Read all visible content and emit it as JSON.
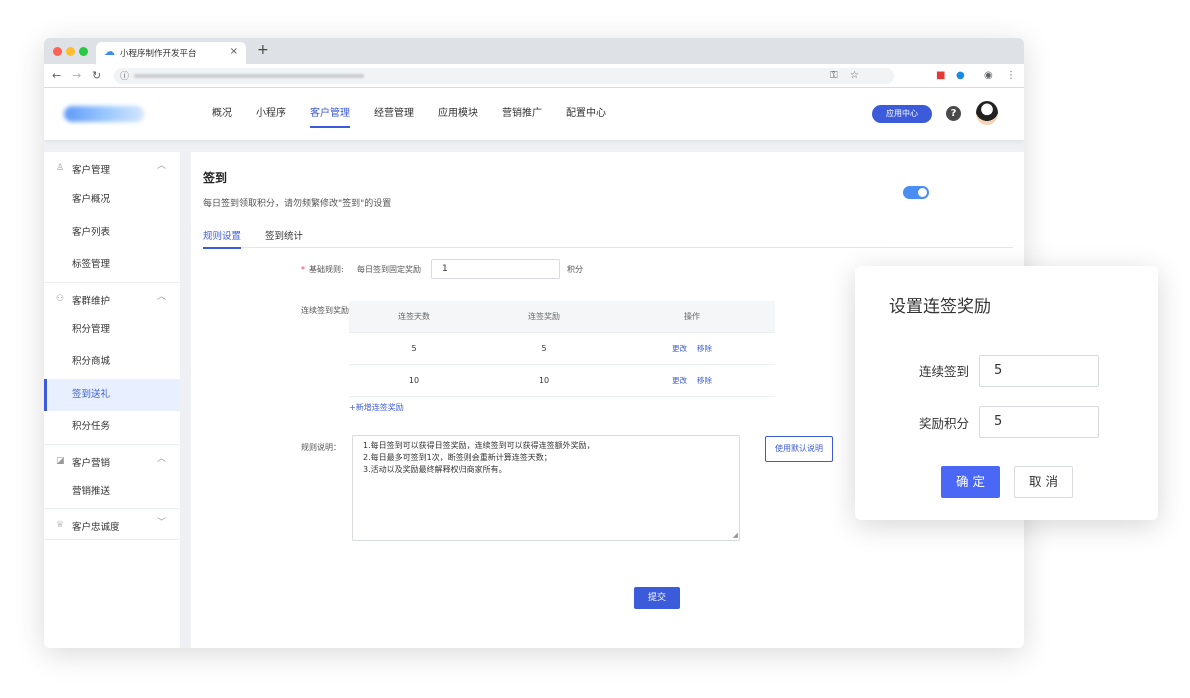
{
  "browser": {
    "tab_title": "小程序制作开发平台",
    "tab_close": "×",
    "new_tab": "+"
  },
  "header": {
    "nav": [
      {
        "label": "概况"
      },
      {
        "label": "小程序"
      },
      {
        "label": "客户管理",
        "active": true
      },
      {
        "label": "经营管理"
      },
      {
        "label": "应用模块"
      },
      {
        "label": "营销推广"
      },
      {
        "label": "配置中心"
      }
    ],
    "app_center": "应用中心",
    "help": "?"
  },
  "sidebar": {
    "groups": [
      {
        "label": "客户管理",
        "icon": "user-icon",
        "items": [
          "客户概况",
          "客户列表",
          "标签管理"
        ]
      },
      {
        "label": "客群维护",
        "icon": "group-icon",
        "items": [
          "积分管理",
          "积分商城",
          "签到送礼",
          "积分任务"
        ]
      },
      {
        "label": "客户营销",
        "icon": "megaphone-icon",
        "items": [
          "营销推送"
        ]
      },
      {
        "label": "客户忠诚度",
        "icon": "crown-icon",
        "items": []
      }
    ],
    "active_item": "签到送礼"
  },
  "main": {
    "title": "签到",
    "subtitle": "每日签到领取积分，请勿频繁修改\"签到\"的设置",
    "toggle_on": true,
    "tabs": [
      "规则设置",
      "签到统计"
    ],
    "basic_rule_label": "基础规则:",
    "basic_rule_desc": "每日签到固定奖励",
    "basic_rule_value": "1",
    "basic_rule_unit": "积分",
    "streak_label": "连续签到奖励:",
    "table": {
      "headers": [
        "连签天数",
        "连签奖励",
        "操作"
      ],
      "rows": [
        {
          "days": "5",
          "reward": "5"
        },
        {
          "days": "10",
          "reward": "10"
        }
      ],
      "edit": "更改",
      "remove": "移除"
    },
    "add_link": "+新增连签奖励",
    "rules_label": "规则说明：",
    "rules_text": [
      "1.每日签到可以获得日签奖励，连续签到可以获得连签额外奖励，",
      "2.每日最多可签到1次，断签则会重新计算连签天数；",
      "3.活动以及奖励最终解释权归商家所有。"
    ],
    "default_btn": "使用默认说明",
    "submit": "提交"
  },
  "dialog": {
    "title": "设置连签奖励",
    "days_label": "连续签到",
    "days_value": "5",
    "points_label": "奖励积分",
    "points_value": "5",
    "ok": "确 定",
    "cancel": "取 消"
  }
}
